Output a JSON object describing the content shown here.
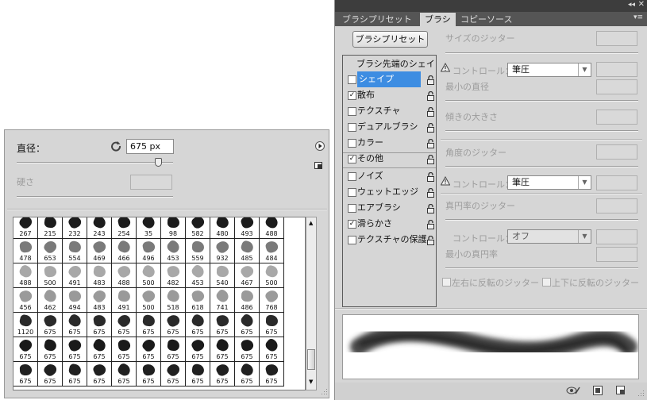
{
  "left_panel": {
    "diameter_label": "直径：",
    "diameter_value": "675 px",
    "hardness_label": "硬さ",
    "presets": [
      [
        "267",
        "215",
        "232",
        "243",
        "254",
        "35",
        "98",
        "582",
        "480",
        "493",
        "488"
      ],
      [
        "478",
        "653",
        "554",
        "469",
        "466",
        "496",
        "453",
        "559",
        "932",
        "485",
        "484"
      ],
      [
        "488",
        "500",
        "491",
        "483",
        "488",
        "500",
        "482",
        "453",
        "540",
        "467",
        "500"
      ],
      [
        "456",
        "462",
        "494",
        "483",
        "491",
        "500",
        "518",
        "618",
        "741",
        "486",
        "768"
      ],
      [
        "1120",
        "675",
        "675",
        "675",
        "675",
        "675",
        "675",
        "675",
        "675",
        "675",
        "675"
      ],
      [
        "675",
        "675",
        "675",
        "675",
        "675",
        "675",
        "675",
        "675",
        "675",
        "675",
        "675"
      ],
      [
        "675",
        "675",
        "675",
        "675",
        "675",
        "675",
        "675",
        "675",
        "675",
        "675",
        "675"
      ]
    ]
  },
  "right_panel": {
    "tabs": [
      "ブラシプリセット",
      "ブラシ",
      "コピーソース"
    ],
    "active_tab": 1,
    "preset_button": "ブラシプリセット",
    "list_header": "ブラシ先端のシェイプ",
    "options": [
      {
        "label": "シェイプ",
        "checked": false,
        "selected": true
      },
      {
        "label": "散布",
        "checked": true,
        "selected": false
      },
      {
        "label": "テクスチャ",
        "checked": false,
        "selected": false
      },
      {
        "label": "デュアルブラシ",
        "checked": false,
        "selected": false
      },
      {
        "label": "カラー",
        "checked": false,
        "selected": false
      },
      {
        "label": "その他",
        "checked": true,
        "selected": false
      },
      {
        "label": "ノイズ",
        "checked": false,
        "selected": false
      },
      {
        "label": "ウェットエッジ",
        "checked": false,
        "selected": false
      },
      {
        "label": "エアブラシ",
        "checked": false,
        "selected": false
      },
      {
        "label": "滑らかさ",
        "checked": true,
        "selected": false
      },
      {
        "label": "テクスチャの保護",
        "checked": false,
        "selected": false
      }
    ],
    "settings": {
      "size_jitter": "サイズのジッター",
      "control_label": "コントロール：",
      "control1_value": "筆圧",
      "min_diameter": "最小の直径",
      "tilt_scale": "傾きの大きさ",
      "angle_jitter": "角度のジッター",
      "control2_value": "筆圧",
      "roundness_jitter": "真円率のジッター",
      "control3_value": "オフ",
      "min_roundness": "最小の真円率",
      "flip_x": "左右に反転のジッター",
      "flip_y": "上下に反転のジッター"
    },
    "colors": {
      "selection": "#3d8de2",
      "panel": "#d6d6d6"
    }
  }
}
